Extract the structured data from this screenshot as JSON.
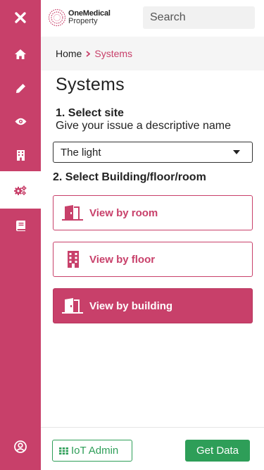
{
  "brand": {
    "name_line1": "OneMedical",
    "name_line2": "Property",
    "accent_color": "#c8406a",
    "success_color": "#2e9e58"
  },
  "header": {
    "search_placeholder": "Search"
  },
  "sidebar": {
    "items": [
      {
        "icon": "close-icon"
      },
      {
        "icon": "home-icon"
      },
      {
        "icon": "pencil-icon"
      },
      {
        "icon": "eye-icon"
      },
      {
        "icon": "building-icon"
      },
      {
        "icon": "gears-icon",
        "active": true
      },
      {
        "icon": "book-icon"
      },
      {
        "icon": "user-circle-icon"
      }
    ]
  },
  "breadcrumb": {
    "home": "Home",
    "current": "Systems"
  },
  "page": {
    "title": "Systems",
    "step1_title": "1. Select site",
    "step1_subtitle": "Give your issue a descriptive name",
    "site_select_value": "The light",
    "step2_title": "2. Select Building/floor/room",
    "buttons": {
      "by_room": "View by room",
      "by_floor": "View by floor",
      "by_building": "View by building"
    }
  },
  "footer": {
    "iot_admin": "IoT Admin",
    "get_data": "Get Data"
  }
}
